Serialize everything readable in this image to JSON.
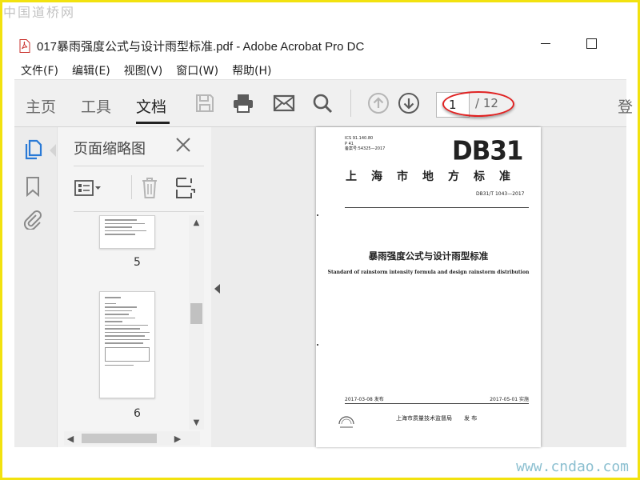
{
  "watermarks": {
    "top_left": "中国道桥网",
    "bottom_right": "www.cndao.com"
  },
  "window": {
    "title": "017暴雨强度公式与设计雨型标准.pdf - Adobe Acrobat Pro DC",
    "app_icon": "pdf-file-icon"
  },
  "menu": [
    "文件(F)",
    "编辑(E)",
    "视图(V)",
    "窗口(W)",
    "帮助(H)"
  ],
  "toolbar": {
    "tabs": [
      "主页",
      "工具",
      "文档"
    ],
    "active_tab": "文档",
    "icons": [
      "save-icon",
      "print-icon",
      "email-icon",
      "search-icon",
      "previous-page-icon",
      "next-page-icon"
    ],
    "page_current": "1",
    "page_total": "/ 12",
    "cut_off_text": "登",
    "annotation_color": "#e02222"
  },
  "left_rail": {
    "icons": [
      "page-thumbnails-icon",
      "bookmarks-icon",
      "attachments-icon"
    ],
    "accent": "#2a7ad6"
  },
  "thumb_panel": {
    "title": "页面缩略图",
    "tools": [
      "thumbnail-options-icon",
      "delete-icon",
      "extract-icon"
    ],
    "pages": [
      {
        "number": "5"
      },
      {
        "number": "6"
      }
    ]
  },
  "document": {
    "meta_lines": [
      "ICS 91.140.80",
      "P 41",
      "备案号:54325—2017"
    ],
    "logo": "DB31",
    "org": "上海市地方标准",
    "std_number": "DB31/T 1043—2017",
    "title_cn": "暴雨强度公式与设计雨型标准",
    "title_en": "Standard of rainstorm intensity formula and design rainstorm distribution",
    "issue_date": "2017-03-08 发布",
    "effective_date": "2017-05-01 实施",
    "issuer": "上海市质量技术监督局",
    "issue_action": "发 布"
  }
}
